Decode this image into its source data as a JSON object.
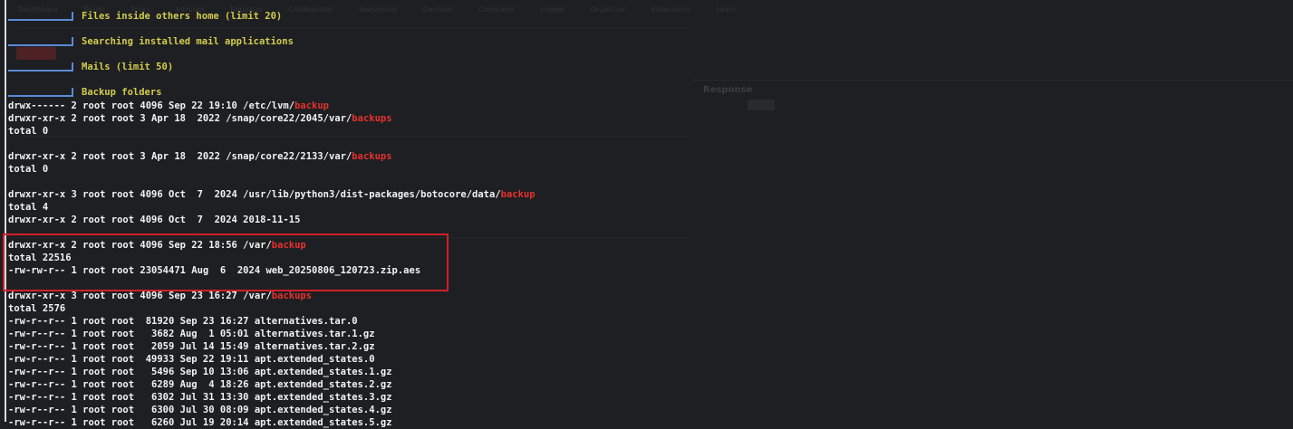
{
  "terminal": {
    "headers": [
      "Files inside others home (limit 20)",
      "Searching installed mail applications",
      "Mails (limit 50)",
      "Backup folders"
    ],
    "lines": [
      {
        "pre": "drwx------ 2 root root 4096 Sep 22 19:10 /etc/lvm/",
        "hl": "backup",
        "post": ""
      },
      {
        "pre": "drwxr-xr-x 2 root root 3 Apr 18  2022 /snap/core22/2045/var/",
        "hl": "backups",
        "post": ""
      },
      {
        "pre": "total 0",
        "hl": "",
        "post": ""
      },
      {
        "pre": "",
        "hl": "",
        "post": ""
      },
      {
        "pre": "drwxr-xr-x 2 root root 3 Apr 18  2022 /snap/core22/2133/var/",
        "hl": "backups",
        "post": ""
      },
      {
        "pre": "total 0",
        "hl": "",
        "post": ""
      },
      {
        "pre": "",
        "hl": "",
        "post": ""
      },
      {
        "pre": "drwxr-xr-x 3 root root 4096 Oct  7  2024 /usr/lib/python3/dist-packages/botocore/data/",
        "hl": "backup",
        "post": ""
      },
      {
        "pre": "total 4",
        "hl": "",
        "post": ""
      },
      {
        "pre": "drwxr-xr-x 2 root root 4096 Oct  7  2024 2018-11-15",
        "hl": "",
        "post": ""
      },
      {
        "pre": "",
        "hl": "",
        "post": ""
      },
      {
        "pre": "drwxr-xr-x 2 root root 4096 Sep 22 18:56 /var/",
        "hl": "backup",
        "post": ""
      },
      {
        "pre": "total 22516",
        "hl": "",
        "post": ""
      },
      {
        "pre": "-rw-rw-r-- 1 root root 23054471 Aug  6  2024 web_20250806_120723.zip.aes",
        "hl": "",
        "post": ""
      },
      {
        "pre": "",
        "hl": "",
        "post": ""
      },
      {
        "pre": "drwxr-xr-x 3 root root 4096 Sep 23 16:27 /var/",
        "hl": "backups",
        "post": ""
      },
      {
        "pre": "total 2576",
        "hl": "",
        "post": ""
      },
      {
        "pre": "-rw-r--r-- 1 root root  81920 Sep 23 16:27 alternatives.tar.0",
        "hl": "",
        "post": ""
      },
      {
        "pre": "-rw-r--r-- 1 root root   3682 Aug  1 05:01 alternatives.tar.1.gz",
        "hl": "",
        "post": ""
      },
      {
        "pre": "-rw-r--r-- 1 root root   2059 Jul 14 15:49 alternatives.tar.2.gz",
        "hl": "",
        "post": ""
      },
      {
        "pre": "-rw-r--r-- 1 root root  49933 Sep 22 19:11 apt.extended_states.0",
        "hl": "",
        "post": ""
      },
      {
        "pre": "-rw-r--r-- 1 root root   5496 Sep 10 13:06 apt.extended_states.1.gz",
        "hl": "",
        "post": ""
      },
      {
        "pre": "-rw-r--r-- 1 root root   6289 Aug  4 18:26 apt.extended_states.2.gz",
        "hl": "",
        "post": ""
      },
      {
        "pre": "-rw-r--r-- 1 root root   6302 Jul 31 13:30 apt.extended_states.3.gz",
        "hl": "",
        "post": ""
      },
      {
        "pre": "-rw-r--r-- 1 root root   6300 Jul 30 08:09 apt.extended_states.4.gz",
        "hl": "",
        "post": ""
      },
      {
        "pre": "-rw-r--r-- 1 root root   6260 Jul 19 20:14 apt.extended_states.5.gz",
        "hl": "",
        "post": ""
      }
    ]
  },
  "background": {
    "tabs": [
      "Dashboard",
      "Target",
      "Proxy",
      "Intruder",
      "Repeater",
      "Collaborator",
      "Sequencer",
      "Decoder",
      "Comparer",
      "Logger",
      "Organizer",
      "Extensions",
      "Learn"
    ],
    "response_label": "Response"
  },
  "colors": {
    "header_text": "#d2cc4e",
    "bracket": "#5b8bd6",
    "highlight": "#e5312f",
    "box": "#d11f2a"
  }
}
